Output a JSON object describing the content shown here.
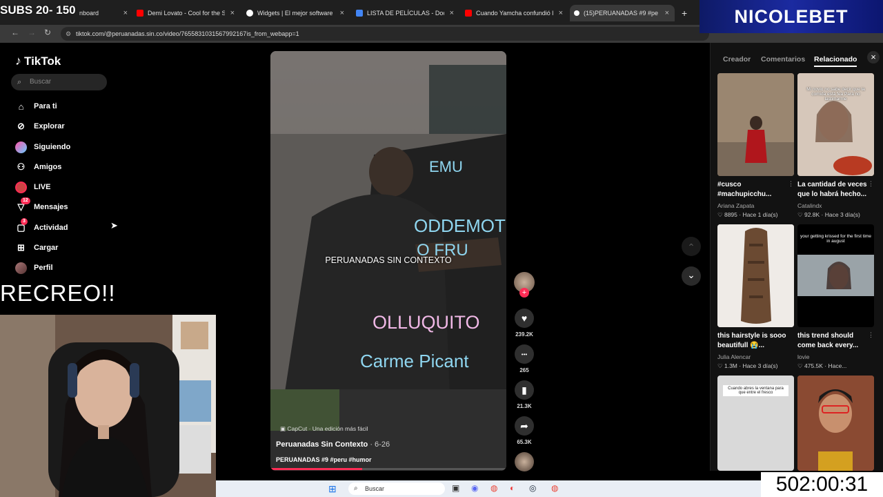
{
  "overlay": {
    "subs_text": "SUBS 20- 150",
    "recreo_text": "RECREO!!",
    "brand_text": "NICOLEBET",
    "timer_text": "502:00:31"
  },
  "browser": {
    "tabs": [
      {
        "label": "nboard",
        "fav_color": "#1a1a1a"
      },
      {
        "label": "Demi Lovato - Cool for the Sum",
        "fav_color": "#ff0000"
      },
      {
        "label": "Widgets | El mejor software pa",
        "fav_color": "#ffffff"
      },
      {
        "label": "LISTA DE PELÍCULAS - Docume",
        "fav_color": "#4285f4"
      },
      {
        "label": "Cuando Yamcha confundió las",
        "fav_color": "#ff0000"
      },
      {
        "label": "(15)PERUANADAS #9 #peru",
        "fav_color": "#ffffff"
      }
    ],
    "close_glyph": "×",
    "newtab_glyph": "+",
    "url": "tiktok.com/@peruanadas.sin.co/video/7655831031567992167is_from_webapp=1"
  },
  "tiktok": {
    "logo": "TikTok",
    "search_placeholder": "Buscar",
    "nav": [
      {
        "label": "Para ti",
        "icon": "home-icon",
        "glyph": "⌂",
        "badge": ""
      },
      {
        "label": "Explorar",
        "icon": "compass-icon",
        "glyph": "⊘",
        "badge": ""
      },
      {
        "label": "Siguiendo",
        "icon": "following-avatar-icon",
        "glyph": "●",
        "badge": ""
      },
      {
        "label": "Amigos",
        "icon": "friends-icon",
        "glyph": "⚇",
        "badge": ""
      },
      {
        "label": "LIVE",
        "icon": "live-icon",
        "glyph": "●",
        "badge": ""
      },
      {
        "label": "Mensajes",
        "icon": "messages-icon",
        "glyph": "▽",
        "badge": "12"
      },
      {
        "label": "Actividad",
        "icon": "activity-icon",
        "glyph": "▢",
        "badge": "3"
      },
      {
        "label": "Cargar",
        "icon": "upload-icon",
        "glyph": "⊞",
        "badge": ""
      },
      {
        "label": "Perfil",
        "icon": "profile-avatar-icon",
        "glyph": "●",
        "badge": ""
      }
    ]
  },
  "video": {
    "caption_overlay": "PERUANADAS SIN CONTEXTO",
    "capcut": "CapCut · Una edición más fácil",
    "author": "Peruanadas Sin Contexto",
    "date": " · 6-26",
    "description": "PERUANADAS #9 #peru #humor",
    "chalk_lines": [
      "EMU",
      "ODDEMOT",
      "O FRU",
      "OLLUQUITO",
      "Carme Picant"
    ],
    "progress": 0.39,
    "actions": [
      {
        "name": "like",
        "glyph": "♥",
        "count": "239.2K"
      },
      {
        "name": "comment",
        "glyph": "•••",
        "count": "265"
      },
      {
        "name": "save",
        "glyph": "▮",
        "count": "21.3K"
      },
      {
        "name": "share",
        "glyph": "➦",
        "count": "65.3K"
      }
    ],
    "follow_glyph": "+",
    "nav_up": "⌃",
    "nav_down": "⌄"
  },
  "right_panel": {
    "tabs": [
      "Creador",
      "Comentarios",
      "Relacionado"
    ],
    "active_tab": "Relacionado",
    "close_glyph": "×",
    "cards": [
      {
        "title": "#cusco #machupicchu...",
        "author": "Ariana Zapata",
        "stats": "♡ 8895 · Hace 1 día(s)",
        "thumb_text": "",
        "thumb_color": "#8a7560"
      },
      {
        "title": "La cantidad de veces que lo habrá hecho...",
        "author": "Catalindx",
        "stats": "♡ 92.8K · Hace 3 día(s)",
        "thumb_text": "Mi novio no sabe decir que la comida está fea Para no lastimarme",
        "thumb_color": "#c9b7a8"
      },
      {
        "title": "this hairstyle is sooo beautifull 😭...",
        "author": "Julia Alencar",
        "stats": "♡ 1.3M · Hace 3 día(s)",
        "thumb_text": "",
        "thumb_color": "#ece8e4"
      },
      {
        "title": "this trend should come back every...",
        "author": "lovie",
        "stats": "♡ 475.5K · Hace...",
        "thumb_text": "your getting krissed for the first time in august",
        "thumb_color": "#9aa3a8"
      },
      {
        "title": "",
        "author": "",
        "stats": "",
        "thumb_text": "Cuando abres la ventana para que entre el fresco",
        "thumb_color": "#d9d9d9"
      },
      {
        "title": "",
        "author": "",
        "stats": "",
        "thumb_text": "",
        "thumb_color": "#a05a3e"
      }
    ]
  },
  "taskbar": {
    "search": "Buscar"
  }
}
